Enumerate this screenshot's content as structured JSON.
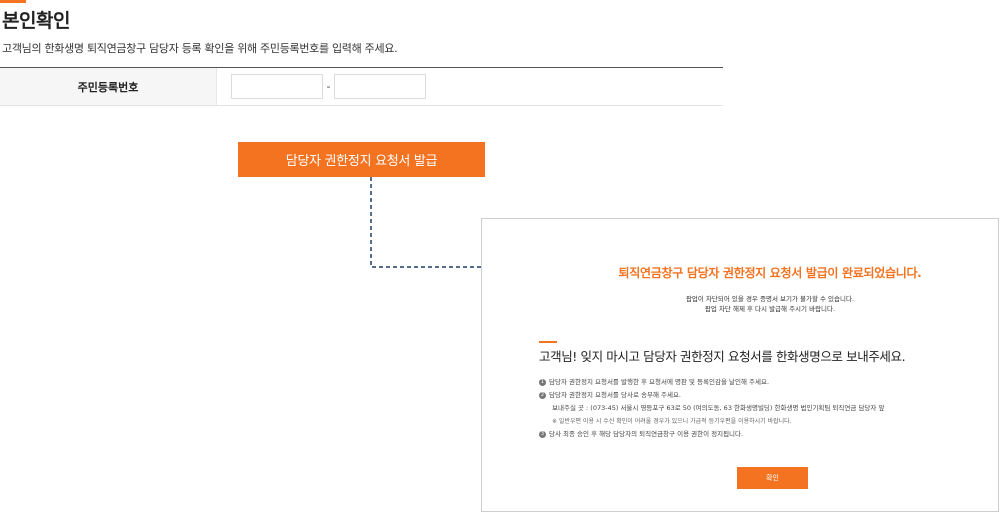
{
  "page": {
    "title": "본인확인",
    "description": "고객님의 한화생명 퇴직연금창구 담당자 등록 확인을 위해 주민등록번호를 입력해 주세요."
  },
  "form": {
    "ssn_label": "주민등록번호",
    "ssn_front_value": "",
    "ssn_back_value": "",
    "separator": "-"
  },
  "actions": {
    "issue_label": "담당자 권한정지 요청서 발급"
  },
  "popup": {
    "title": "퇴직연금창구 담당자 권한정지 요청서 발급이 완료되었습니다.",
    "notice_line1": "팝업이 차단되어 있을 경우 증명서 보기가 불가할 수 있습니다.",
    "notice_line2": "팝업 차단 해제 후 다시 발급해 주시기 바랍니다.",
    "heading": "고객님! 잊지 마시고 담당자 권한정지 요청서를 한화생명으로 보내주세요.",
    "step1_num": "1",
    "step1": "담당자 권한정지 요청서를 발행한 후 요청서에 명판 및 등록인감을 날인해 주세요.",
    "step2_num": "2",
    "step2": "담당자 권한정지 요청서를 당사로 송부해 주세요.",
    "step2_address": "보내주실 곳 : (073-45) 서울시 영등포구 63로 50 (여의도동, 63 한화생명빌딩) 한화생명 법인기획팀 퇴직연금 담당자 앞",
    "step2_note": "※ 일반우편 이용 시 수신 확인이 어려울 경우가 있으니 가급적 등기우편을 이용하시기 바랍니다.",
    "step3_num": "3",
    "step3": "당사 최종 승인 후 해당 담당자의 퇴직연금창구 이용 권한이 정지됩니다.",
    "confirm_label": "확인"
  },
  "colors": {
    "accent": "#f37321",
    "connector": "#1f3b6b"
  }
}
